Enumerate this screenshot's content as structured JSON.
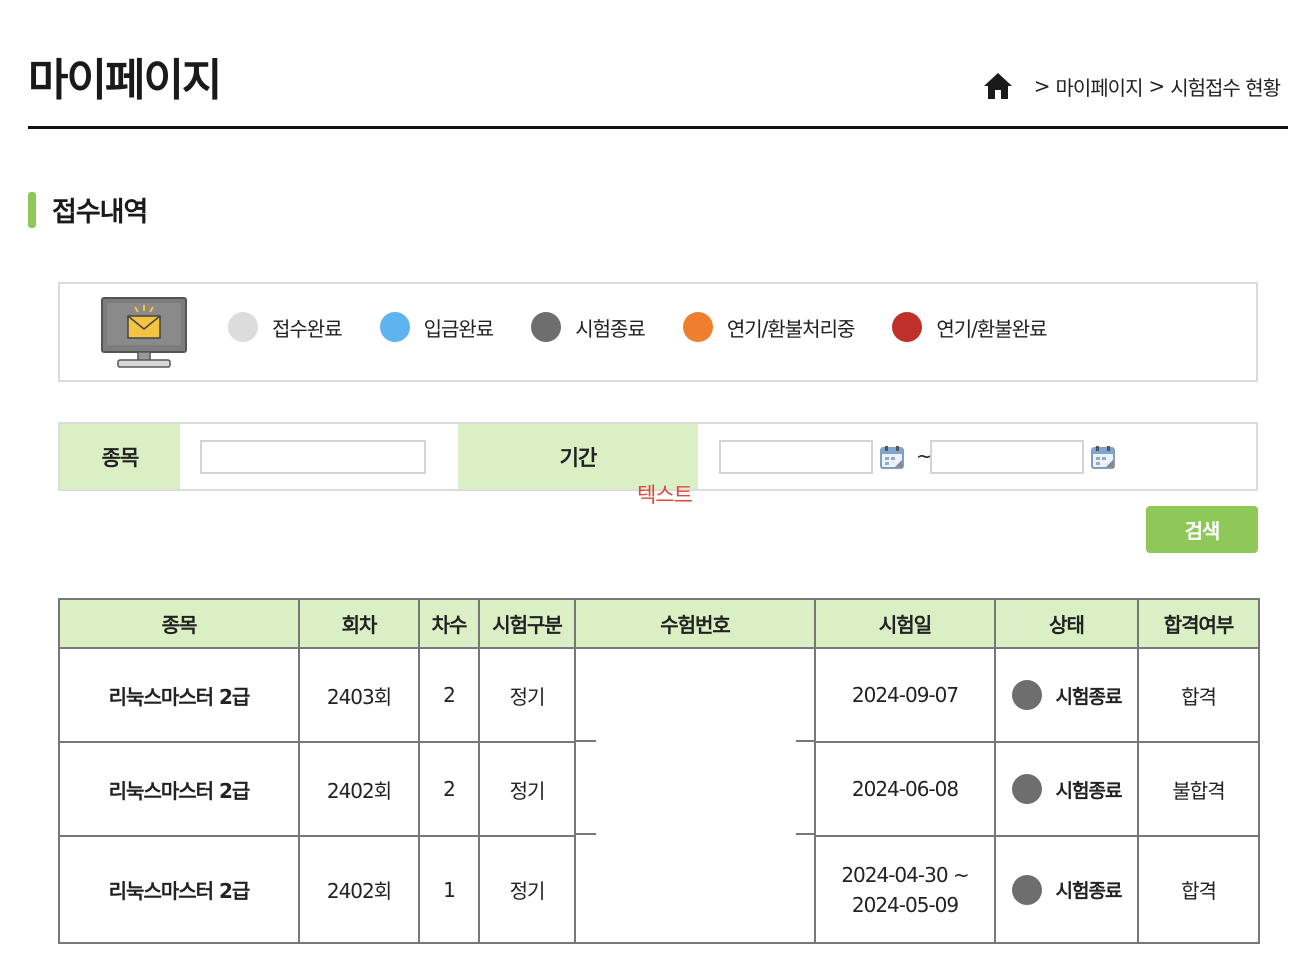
{
  "page": {
    "title": "마이페이지"
  },
  "breadcrumb": {
    "sep1": ">",
    "item1": "마이페이지",
    "sep2": ">",
    "item2": "시험접수 현황"
  },
  "section": {
    "title": "접수내역"
  },
  "legend": [
    {
      "label": "접수완료",
      "color": "#dcdcdc"
    },
    {
      "label": "입금완료",
      "color": "#5db4ee"
    },
    {
      "label": "시험종료",
      "color": "#6e6e6e"
    },
    {
      "label": "연기/환불처리중",
      "color": "#ef7f2e"
    },
    {
      "label": "연기/환불완료",
      "color": "#c0302a"
    }
  ],
  "search": {
    "category_label": "종목",
    "category_value": "",
    "period_label": "기간",
    "start_date": "",
    "end_date": "",
    "range_sep": "~",
    "overlay_text": "텍스트",
    "button_label": "검색"
  },
  "table": {
    "headers": [
      "종목",
      "회차",
      "차수",
      "시험구분",
      "수험번호",
      "시험일",
      "상태",
      "합격여부"
    ],
    "rows": [
      {
        "subject": "리눅스마스터 2급",
        "round": "2403회",
        "order": "2",
        "type": "정기",
        "exam_no": "",
        "date": "2024-09-07",
        "date2": "",
        "status": "시험종료",
        "result": "합격"
      },
      {
        "subject": "리눅스마스터 2급",
        "round": "2402회",
        "order": "2",
        "type": "정기",
        "exam_no": "",
        "date": "2024-06-08",
        "date2": "",
        "status": "시험종료",
        "result": "불합격"
      },
      {
        "subject": "리눅스마스터 2급",
        "round": "2402회",
        "order": "1",
        "type": "정기",
        "exam_no": "",
        "date": "2024-04-30 ~",
        "date2": "2024-05-09",
        "status": "시험종료",
        "result": "합격"
      }
    ],
    "status_color": "#6e6e6e"
  }
}
